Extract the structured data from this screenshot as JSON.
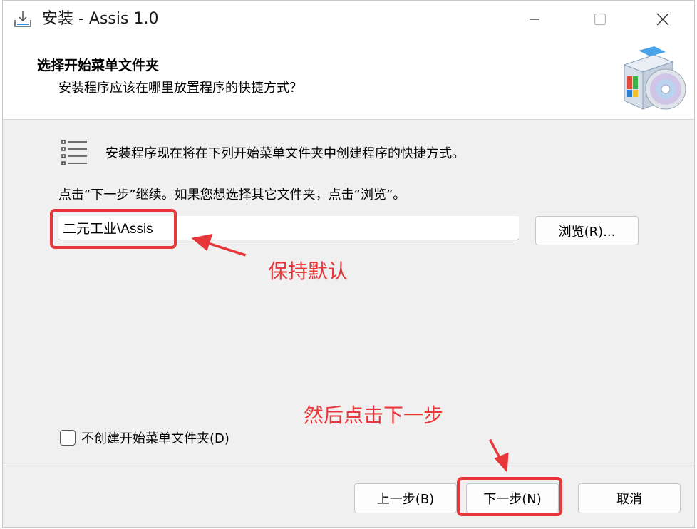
{
  "window": {
    "title": "安装 - Assis 1.0",
    "controls": {
      "minimize_icon": "minimize-icon",
      "maximize_icon": "maximize-icon",
      "close_icon": "close-icon"
    }
  },
  "header": {
    "title": "选择开始菜单文件夹",
    "subtitle": "安装程序应该在哪里放置程序的快捷方式？"
  },
  "body": {
    "info_text": "安装程序现在将在下列开始菜单文件夹中创建程序的快捷方式。",
    "instruction_text": "点击“下一步”继续。如果您想选择其它文件夹，点击“浏览”。",
    "folder_input_value": "二元工业\\Assis",
    "browse_label": "浏览(R)...",
    "checkbox_label": "不创建开始菜单文件夹(D)",
    "checkbox_checked": false
  },
  "footer": {
    "back_label": "上一步(B)",
    "next_label": "下一步(N)",
    "cancel_label": "取消"
  },
  "annotations": {
    "keep_default": "保持默认",
    "then_click_next": "然后点击下一步",
    "color": "#e8373a"
  }
}
